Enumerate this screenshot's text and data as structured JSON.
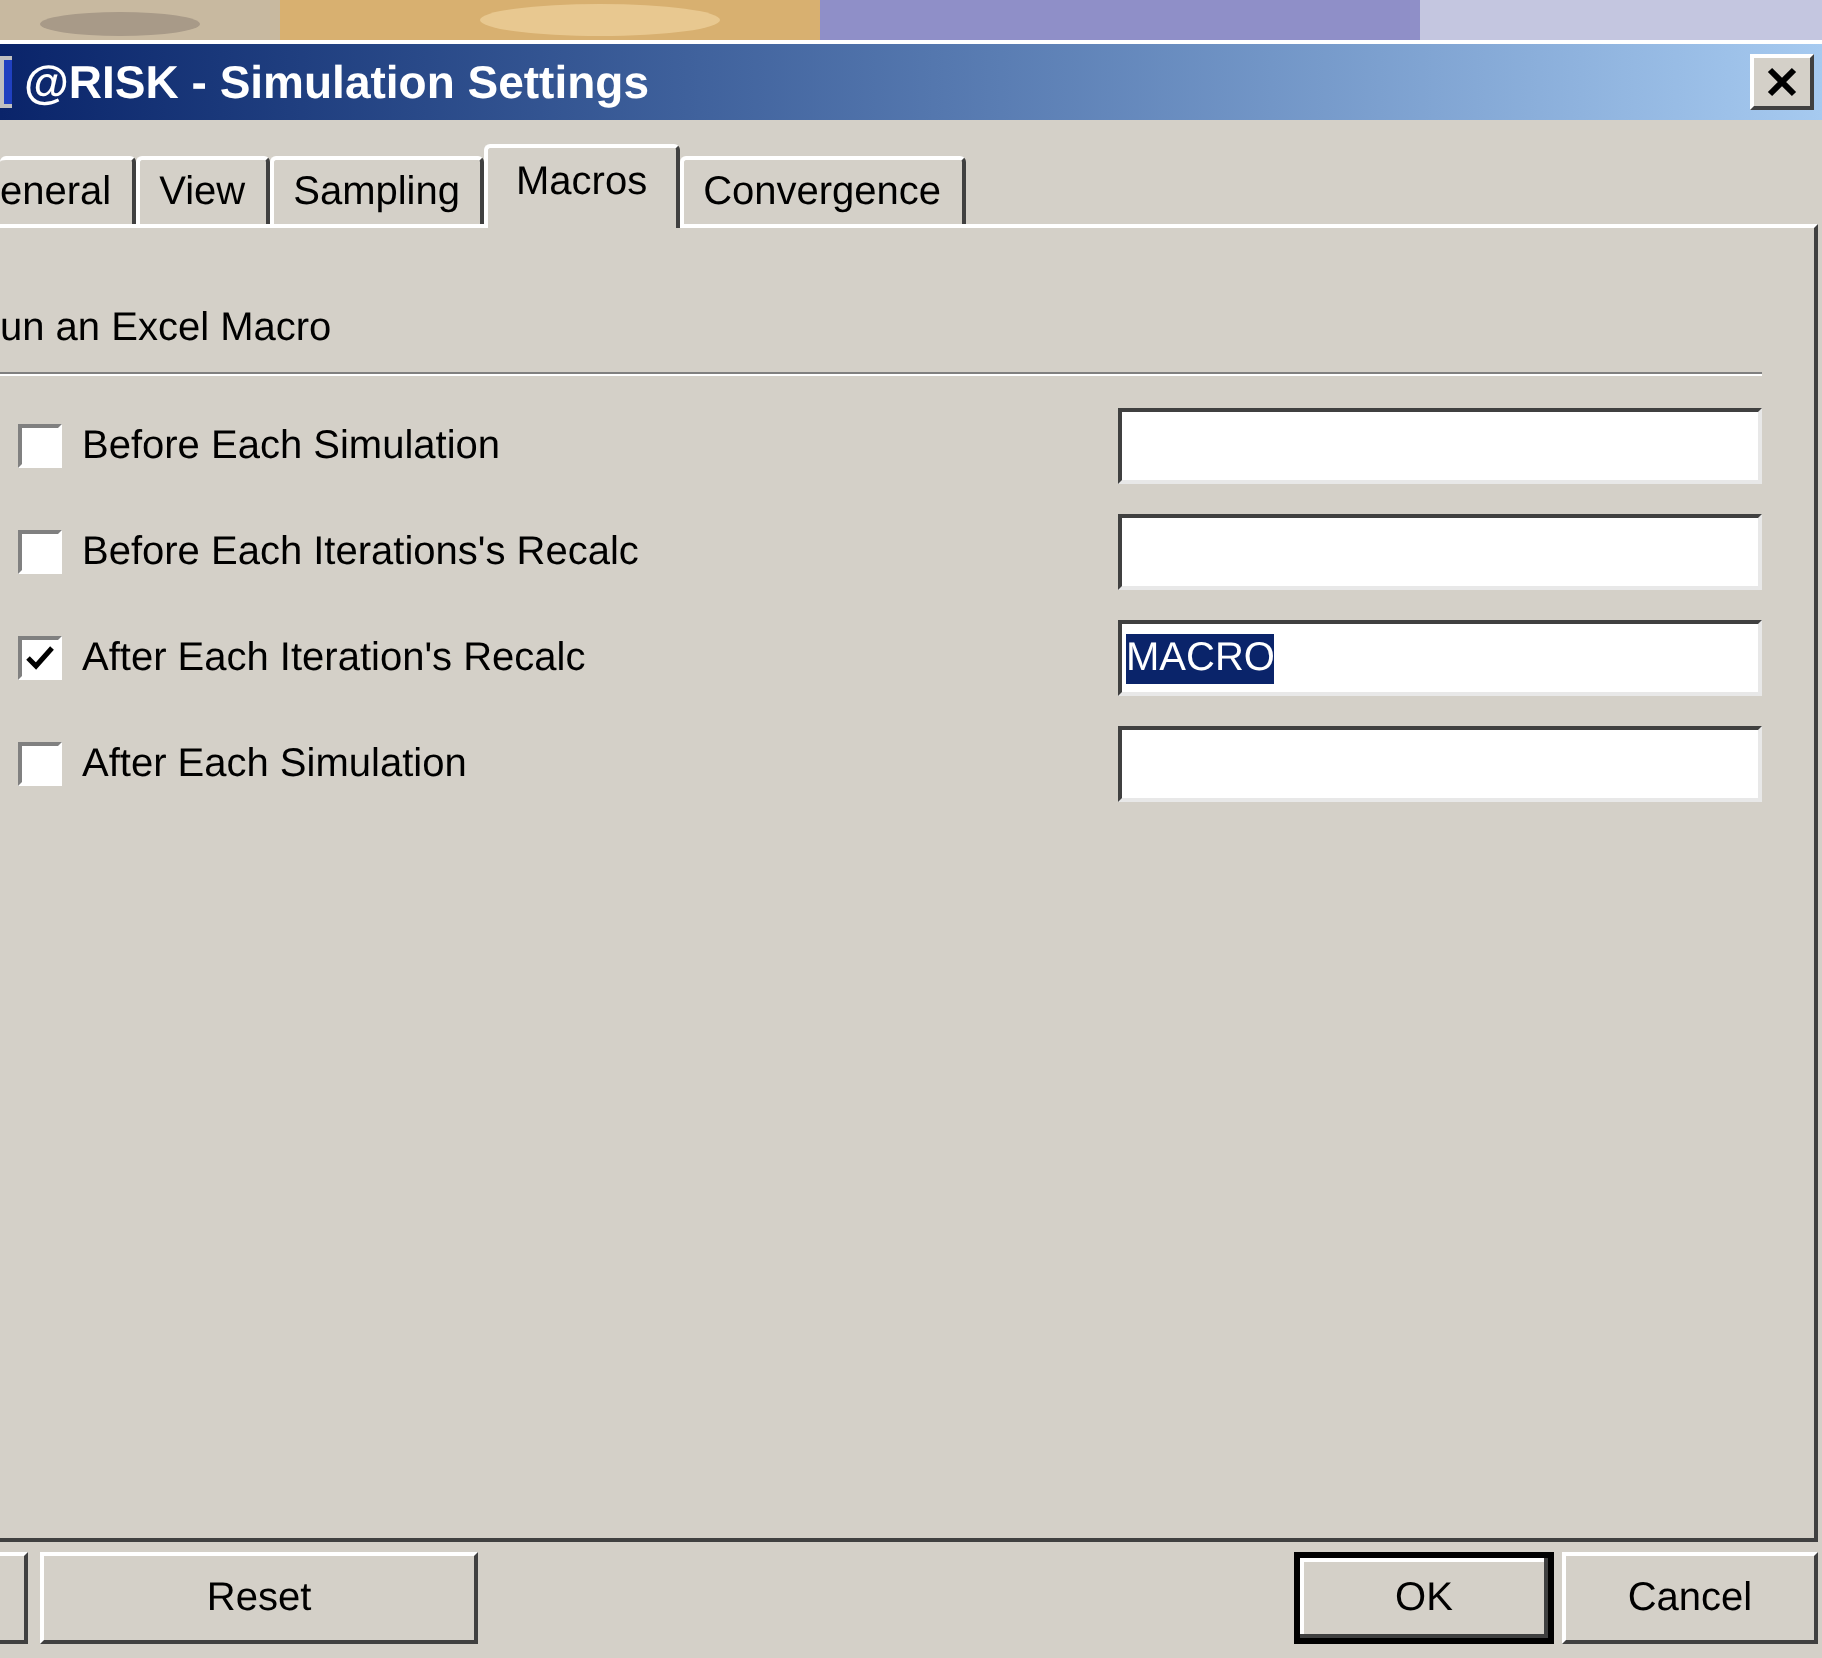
{
  "window": {
    "title": "@RISK - Simulation Settings"
  },
  "tabs": [
    {
      "label": "eneral",
      "selected": false
    },
    {
      "label": "View",
      "selected": false
    },
    {
      "label": "Sampling",
      "selected": false
    },
    {
      "label": "Macros",
      "selected": true
    },
    {
      "label": "Convergence",
      "selected": false
    }
  ],
  "group": {
    "title": "un an Excel Macro"
  },
  "macros": [
    {
      "label": "Before Each Simulation",
      "checked": false
    },
    {
      "label": "Before Each Iterations's Recalc",
      "checked": false
    },
    {
      "label": "After Each Iteration's Recalc",
      "checked": true,
      "value": "MACRO",
      "value_selected": true
    },
    {
      "label": "After Each Simulation",
      "checked": false
    }
  ],
  "buttons": [
    {
      "label": "Reset",
      "default": false
    },
    {
      "label": "OK",
      "default": true
    },
    {
      "label": "Cancel",
      "default": false
    }
  ]
}
